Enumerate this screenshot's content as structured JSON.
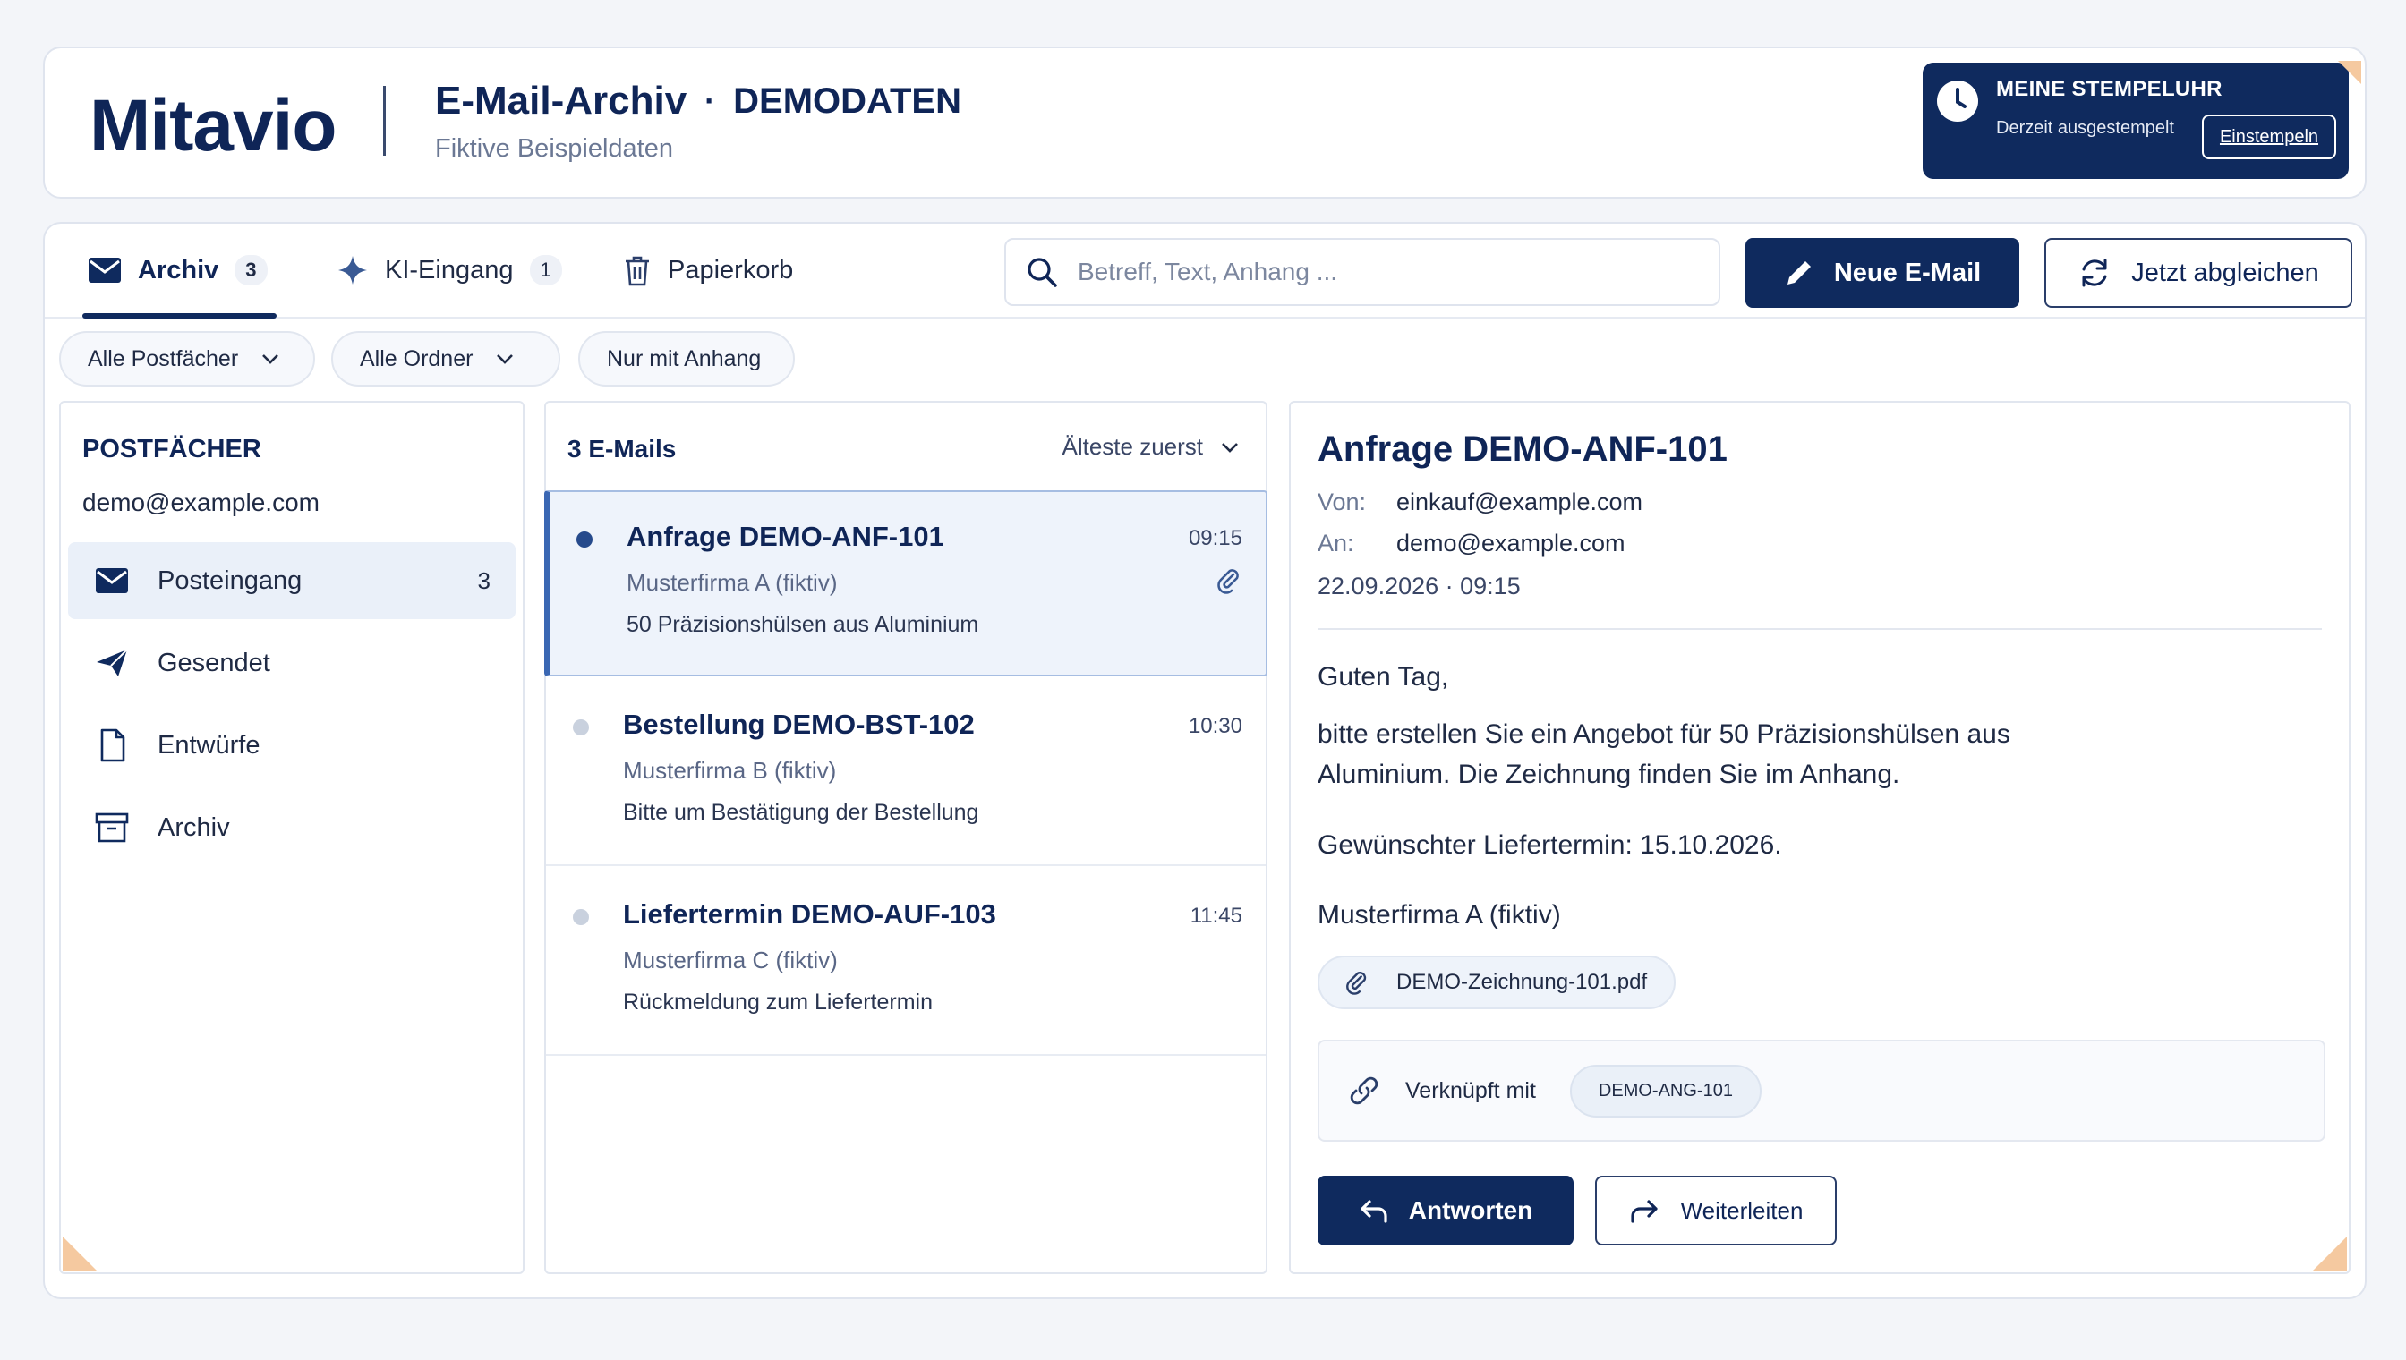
{
  "header": {
    "brand": "Mitavio",
    "title": "E-Mail-Archiv",
    "separator": "·",
    "tag": "DEMODATEN",
    "subtitle": "Fiktive Beispieldaten"
  },
  "clock": {
    "title": "MEINE STEMPELUHR",
    "status": "Derzeit ausgestempelt",
    "button": "Einstempeln"
  },
  "tabs": [
    {
      "label": "Archiv",
      "badge": "3",
      "icon": "mail-icon"
    },
    {
      "label": "KI-Eingang",
      "badge": "1",
      "icon": "sparkle-icon"
    },
    {
      "label": "Papierkorb",
      "icon": "trash-icon"
    }
  ],
  "search": {
    "placeholder": "Betreff, Text, Anhang ..."
  },
  "actions": {
    "new_mail": "Neue E-Mail",
    "sync": "Jetzt abgleichen"
  },
  "filters": [
    {
      "label": "Alle Postfächer"
    },
    {
      "label": "Alle Ordner"
    },
    {
      "label": "Nur mit Anhang"
    }
  ],
  "mailboxes": {
    "heading": "POSTFÄCHER",
    "address": "demo@example.com",
    "folders": [
      {
        "label": "Posteingang",
        "count": "3",
        "icon": "inbox-icon"
      },
      {
        "label": "Gesendet",
        "icon": "send-icon"
      },
      {
        "label": "Entwürfe",
        "icon": "file-icon"
      },
      {
        "label": "Archiv",
        "icon": "archive-icon"
      }
    ]
  },
  "list": {
    "count_label": "3 E-Mails",
    "sort_label": "Älteste zuerst",
    "mails": [
      {
        "title": "Anfrage DEMO-ANF-101",
        "time": "09:15",
        "from": "Musterfirma A (fiktiv)",
        "subject": "50 Präzisionshülsen aus Aluminium",
        "attachment": true
      },
      {
        "title": "Bestellung DEMO-BST-102",
        "time": "10:30",
        "from": "Musterfirma B (fiktiv)",
        "subject": "Bitte um Bestätigung der Bestellung"
      },
      {
        "title": "Liefertermin DEMO-AUF-103",
        "time": "11:45",
        "from": "Musterfirma C (fiktiv)",
        "subject": "Rückmeldung zum Liefertermin"
      }
    ]
  },
  "detail": {
    "title": "Anfrage DEMO-ANF-101",
    "from_label": "Von:",
    "from": "einkauf@example.com",
    "to_label": "An:",
    "to": "demo@example.com",
    "date": "22.09.2026 · 09:15",
    "greeting": "Guten Tag,",
    "body_line1": "bitte erstellen Sie ein Angebot für 50 Präzisionshülsen aus",
    "body_line2": "Aluminium. Die Zeichnung finden Sie im Anhang.",
    "delivery": "Gewünschter Liefertermin: 15.10.2026.",
    "signature": "Musterfirma A (fiktiv)",
    "attachment": "DEMO-Zeichnung-101.pdf",
    "linked_label": "Verknüpft mit",
    "linked_chip": "DEMO-ANG-101",
    "reply": "Antworten",
    "forward": "Weiterleiten"
  },
  "colors": {
    "navy": "#0f2a5e",
    "accent_corner": "#f5c9a0",
    "active_bg": "#eef3fb"
  }
}
